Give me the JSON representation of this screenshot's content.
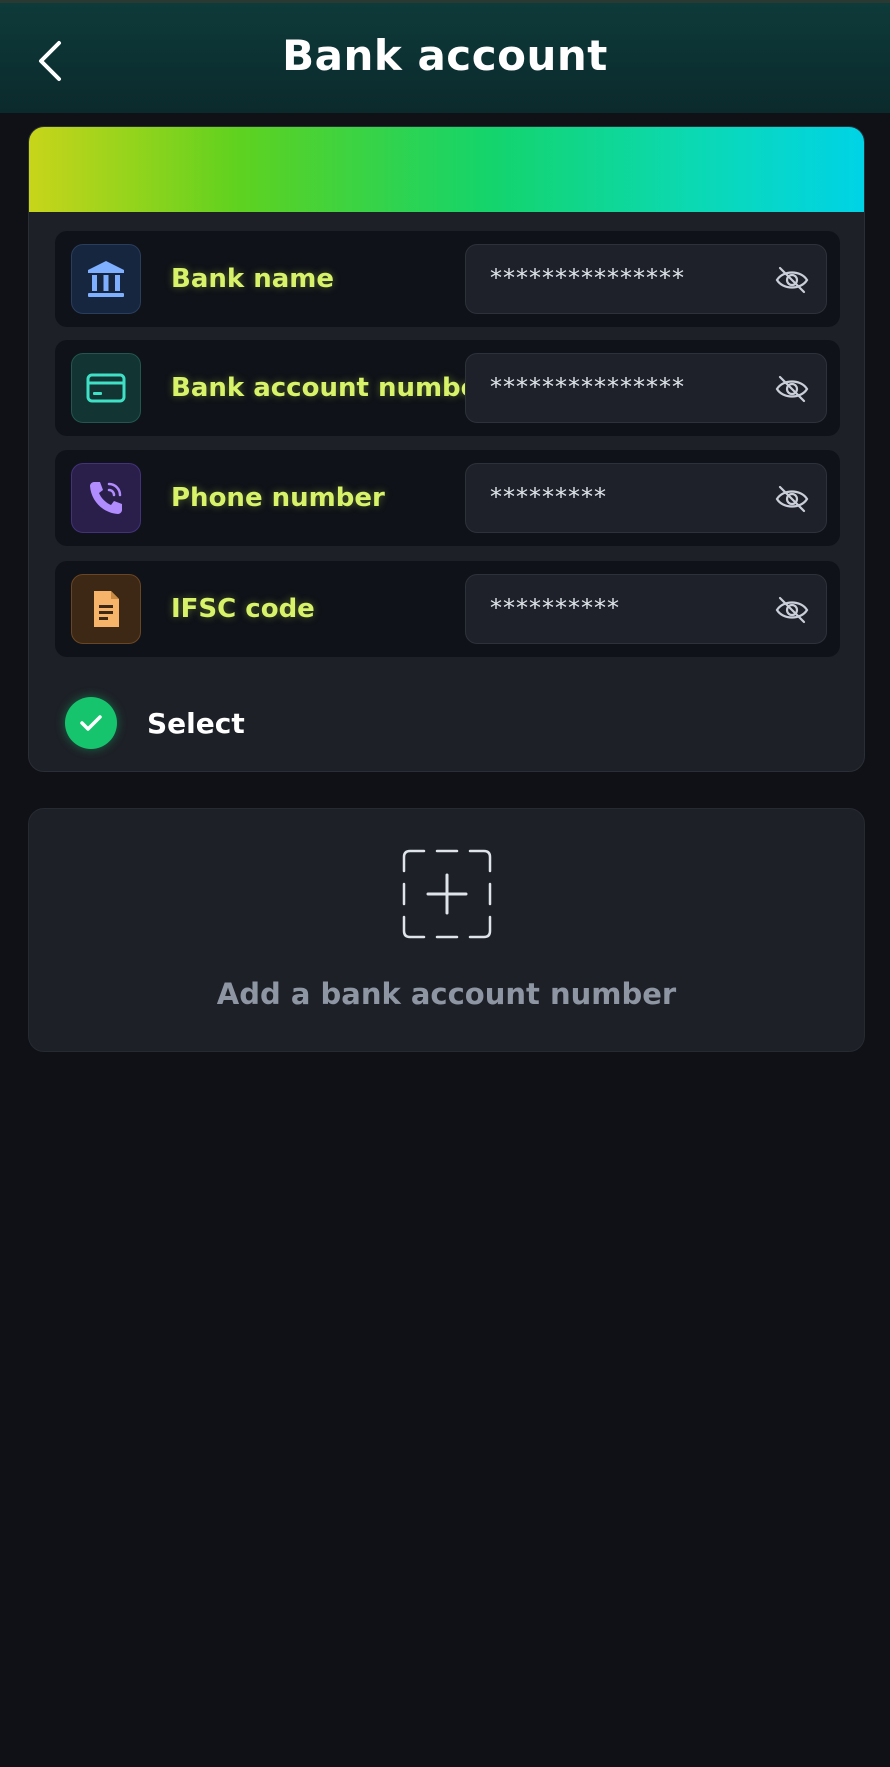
{
  "header": {
    "title": "Bank account"
  },
  "card": {
    "rows": [
      {
        "label": "Bank name",
        "value": "***************",
        "icon": "bank-icon"
      },
      {
        "label": "Bank account number",
        "value": "***************",
        "icon": "credit-card-icon"
      },
      {
        "label": "Phone number",
        "value": "*********",
        "icon": "phone-icon"
      },
      {
        "label": "IFSC code",
        "value": "**********",
        "icon": "document-icon"
      }
    ],
    "select_label": "Select"
  },
  "add": {
    "label": "Add a bank account number"
  },
  "colors": {
    "accent_green": "#16c46d",
    "label_lime": "#d8f26a",
    "background": "#0f1116"
  }
}
